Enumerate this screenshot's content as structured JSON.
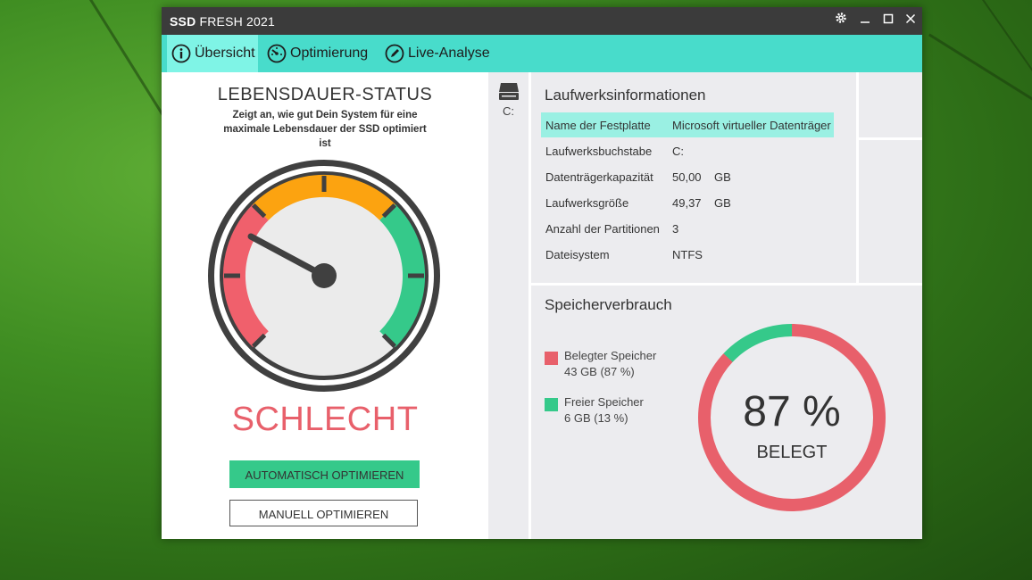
{
  "window": {
    "title_bold": "SSD",
    "title_rest": "FRESH 2021"
  },
  "tabs": [
    {
      "label": "Übersicht",
      "icon": "info-icon",
      "active": true
    },
    {
      "label": "Optimierung",
      "icon": "speedometer-icon",
      "active": false
    },
    {
      "label": "Live-Analyse",
      "icon": "pencil-icon",
      "active": false
    }
  ],
  "status": {
    "title": "LEBENSDAUER-STATUS",
    "description": "Zeigt an, wie gut Dein System für eine maximale Lebensdauer der SSD optimiert ist",
    "rating": "SCHLECHT",
    "rating_color": "#e8606b",
    "auto_button": "AUTOMATISCH OPTIMIEREN",
    "manual_button": "MANUELL OPTIMIEREN"
  },
  "drive": {
    "label": "C:",
    "icon": "hard-drive-icon"
  },
  "drive_info": {
    "title": "Laufwerksinformationen",
    "rows": [
      {
        "key": "Name der Festplatte",
        "value": "Microsoft virtueller Datenträger"
      },
      {
        "key": "Laufwerksbuchstabe",
        "value": "C:"
      },
      {
        "key": "Datenträgerkapazität",
        "value": "50,00    GB"
      },
      {
        "key": "Laufwerksgröße",
        "value": "49,37    GB"
      },
      {
        "key": "Anzahl der Partitionen",
        "value": "3"
      },
      {
        "key": "Dateisystem",
        "value": "NTFS"
      }
    ]
  },
  "usage": {
    "title": "Speicherverbrauch",
    "used_label": "Belegter Speicher",
    "used_value": "43 GB (87 %)",
    "used_color": "#e8606b",
    "free_label": "Freier Speicher",
    "free_value": "6 GB (13 %)",
    "free_color": "#35c98a",
    "percent_text": "87 %",
    "percent_caption": "BELEGT",
    "used_fraction": 0.87
  },
  "colors": {
    "accent": "#48dccb",
    "active_tab": "#7ff4e6",
    "titlebar": "#3b3b3b",
    "gauge_red": "#f0606c",
    "gauge_orange": "#fca310",
    "gauge_green": "#35c98a"
  }
}
